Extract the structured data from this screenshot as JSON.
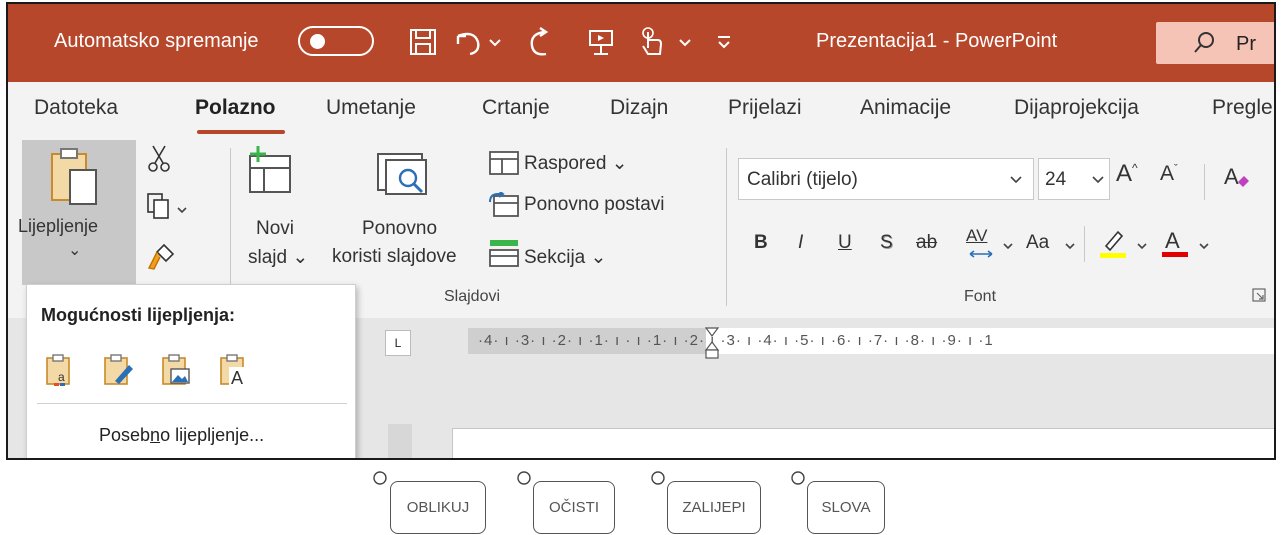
{
  "titlebar": {
    "autosave_label": "Automatsko spremanje",
    "autosave_state": "off",
    "title": "Prezentacija1  -  PowerPoint",
    "search_text": "Pr",
    "accent_color": "#b7472a"
  },
  "tabs": [
    {
      "label": "Datoteka",
      "active": false
    },
    {
      "label": "Polazno",
      "active": true
    },
    {
      "label": "Umetanje",
      "active": false
    },
    {
      "label": "Crtanje",
      "active": false
    },
    {
      "label": "Dizajn",
      "active": false
    },
    {
      "label": "Prijelazi",
      "active": false
    },
    {
      "label": "Animacije",
      "active": false
    },
    {
      "label": "Dijaprojekcija",
      "active": false
    },
    {
      "label": "Pregle",
      "active": false
    }
  ],
  "ribbon": {
    "clipboard": {
      "paste_label": "Lijepljenje",
      "paste_chevron": "⌄"
    },
    "slides": {
      "new_slide_line1": "Novi",
      "new_slide_line2": "slajd ⌄",
      "reuse_line1": "Ponovno",
      "reuse_line2": "koristi slajdove",
      "layout_label": "Raspored ⌄",
      "reset_label": "Ponovno postavi",
      "section_label": "Sekcija ⌄",
      "group_label": "Slajdovi"
    },
    "font": {
      "font_name": "Calibri (tijelo)",
      "font_size": "24",
      "group_label": "Font",
      "bold": "B",
      "italic": "I",
      "underline": "U",
      "shadow": "S",
      "strike": "ab",
      "spacing": "AV",
      "case": "Aa",
      "grow": "A",
      "shrink": "A",
      "font_color": "A",
      "highlight_color": "#ffff00",
      "font_color_value": "#e00000"
    }
  },
  "ruler": {
    "numbers": "·4· ı ·3· ı ·2· ı ·1· ı ·  ı ·1· ı ·2· ı ·3· ı ·4· ı ·5· ı ·6· ı ·7· ı ·8· ı ·9· ı ·1"
  },
  "paste_menu": {
    "title": "Mogućnosti lijepljenja:",
    "options": [
      "paste-destination-theme-icon",
      "paste-keep-source-format-icon",
      "paste-picture-icon",
      "paste-keep-text-only-icon"
    ],
    "special_prefix": "Poseb",
    "special_underlined": "n",
    "special_suffix": "o lijepljenje..."
  },
  "hint_buttons": [
    "OBLIKUJ",
    "OČISTI",
    "ZALIJEPI",
    "SLOVA"
  ]
}
